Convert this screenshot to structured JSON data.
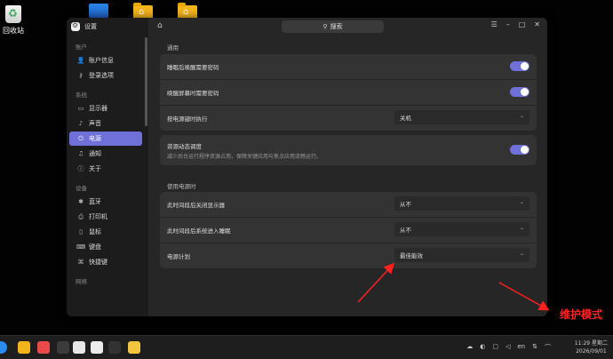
{
  "desktop": {
    "trash_label": "回收站"
  },
  "window": {
    "app_title": "设置",
    "search_placeholder": "搜索",
    "sidebar": {
      "groups": [
        {
          "label": "账户",
          "items": [
            {
              "label": "账户信息",
              "icon": "user-icon"
            },
            {
              "label": "登录选项",
              "icon": "key-icon"
            }
          ]
        },
        {
          "label": "系统",
          "items": [
            {
              "label": "显示器",
              "icon": "monitor-icon"
            },
            {
              "label": "声音",
              "icon": "speaker-icon"
            },
            {
              "label": "电源",
              "icon": "power-icon",
              "active": true
            },
            {
              "label": "通知",
              "icon": "bell-icon"
            },
            {
              "label": "关于",
              "icon": "info-icon"
            }
          ]
        },
        {
          "label": "设备",
          "items": [
            {
              "label": "蓝牙",
              "icon": "bluetooth-icon"
            },
            {
              "label": "打印机",
              "icon": "printer-icon"
            },
            {
              "label": "鼠标",
              "icon": "mouse-icon"
            },
            {
              "label": "键盘",
              "icon": "keyboard-icon"
            },
            {
              "label": "快捷键",
              "icon": "shortcut-icon"
            }
          ]
        },
        {
          "label": "网络",
          "items": []
        }
      ]
    },
    "general": {
      "title": "通用",
      "wake_password_sleep": "睡眠后唤醒需要密码",
      "wake_password_screen": "唤醒屏幕时需要密码",
      "power_button_label": "按电源键时执行",
      "power_button_value": "关机",
      "resource_label": "资源动态调度",
      "resource_desc": "减少后台运行程序资源占用，保障关键应用与焦点应用流畅运行。"
    },
    "on_power": {
      "title": "使用电源时",
      "display_off_label": "此时间段后关闭显示器",
      "display_off_value": "从不",
      "sleep_label": "此时间段后系统进入睡眠",
      "sleep_value": "从不",
      "plan_label": "电源计划",
      "plan_value": "最佳能效"
    }
  },
  "annotation": {
    "text": "维护模式",
    "color": "#ff2020"
  },
  "accent_color": "#7071d8",
  "taskbar": {
    "lang": "en",
    "time": "11:29 星期二",
    "date": "2026/09/01"
  }
}
